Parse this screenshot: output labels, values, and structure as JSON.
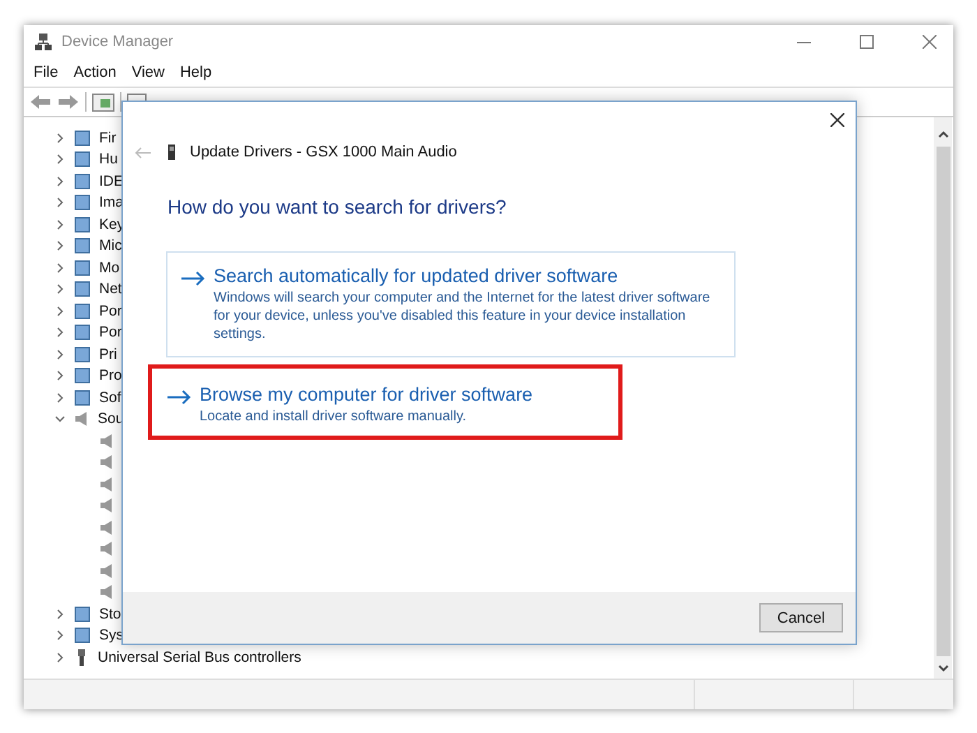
{
  "window": {
    "title": "Device Manager"
  },
  "menu": [
    "File",
    "Action",
    "View",
    "Help"
  ],
  "tree": [
    {
      "label": "Fir",
      "kind": "device",
      "expanded": false
    },
    {
      "label": "Hu",
      "kind": "device",
      "expanded": false
    },
    {
      "label": "IDE",
      "kind": "device",
      "expanded": false
    },
    {
      "label": "Ima",
      "kind": "device",
      "expanded": false
    },
    {
      "label": "Key",
      "kind": "device",
      "expanded": false
    },
    {
      "label": "Mic",
      "kind": "device",
      "expanded": false
    },
    {
      "label": "Mo",
      "kind": "device",
      "expanded": false
    },
    {
      "label": "Net",
      "kind": "device",
      "expanded": false
    },
    {
      "label": "Por",
      "kind": "device",
      "expanded": false
    },
    {
      "label": "Por",
      "kind": "device",
      "expanded": false
    },
    {
      "label": "Pri",
      "kind": "device",
      "expanded": false
    },
    {
      "label": "Pro",
      "kind": "device",
      "expanded": false
    },
    {
      "label": "Sof",
      "kind": "device",
      "expanded": false
    },
    {
      "label": "Sou",
      "kind": "speaker",
      "expanded": true,
      "children": [
        {
          "kind": "speaker"
        },
        {
          "kind": "speaker"
        },
        {
          "kind": "speaker"
        },
        {
          "kind": "speaker"
        },
        {
          "kind": "speaker"
        },
        {
          "kind": "speaker"
        },
        {
          "kind": "speaker"
        },
        {
          "kind": "speaker"
        }
      ]
    },
    {
      "label": "Sto",
      "kind": "device",
      "expanded": false
    },
    {
      "label": "Sys",
      "kind": "device",
      "expanded": false
    },
    {
      "label": "Universal Serial Bus controllers",
      "kind": "usb",
      "expanded": false
    }
  ],
  "dialog": {
    "title": "Update Drivers - GSX 1000 Main Audio",
    "heading": "How do you want to search for drivers?",
    "options": [
      {
        "title": "Search automatically for updated driver software",
        "description": "Windows will search your computer and the Internet for the latest driver software for your device, unless you've disabled this feature in your device installation settings.",
        "bordered": true,
        "highlighted": false
      },
      {
        "title": "Browse my computer for driver software",
        "description": "Locate and install driver software manually.",
        "bordered": false,
        "highlighted": true
      }
    ],
    "buttons": [
      "Cancel"
    ]
  }
}
